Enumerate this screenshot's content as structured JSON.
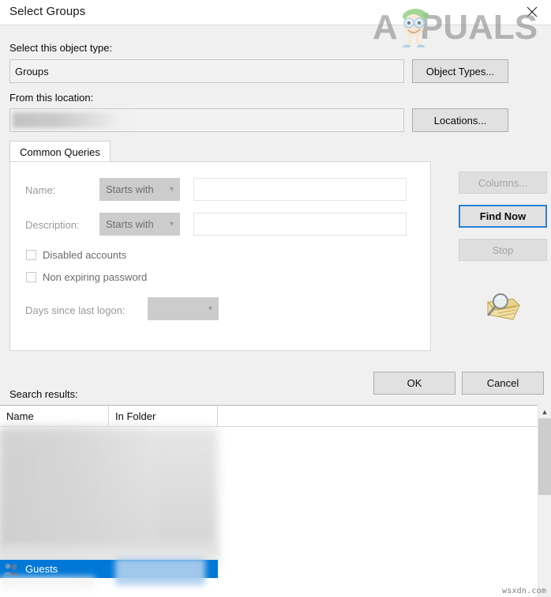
{
  "window": {
    "title": "Select Groups",
    "close_icon": "close-x-icon"
  },
  "watermark": {
    "brand": "APPUALS",
    "footer": "wsxdn.com"
  },
  "object_type": {
    "label": "Select this object type:",
    "value": "Groups",
    "button": "Object Types..."
  },
  "location": {
    "label": "From this location:",
    "value": "",
    "button": "Locations..."
  },
  "tabs": [
    {
      "label": "Common Queries",
      "active": true
    }
  ],
  "query": {
    "name_label": "Name:",
    "name_condition": "Starts with",
    "name_value": "",
    "description_label": "Description:",
    "description_condition": "Starts with",
    "description_value": "",
    "disabled_accounts_label": "Disabled accounts",
    "disabled_accounts_checked": false,
    "non_expiring_password_label": "Non expiring password",
    "non_expiring_password_checked": false,
    "days_since_logon_label": "Days since last logon:",
    "days_since_logon_value": "",
    "caret_icon": "chevron-down-icon"
  },
  "side_buttons": {
    "columns": "Columns...",
    "find_now": "Find Now",
    "stop": "Stop",
    "search_icon": "search-folder-icon"
  },
  "dialog_buttons": {
    "ok": "OK",
    "cancel": "Cancel"
  },
  "results": {
    "label": "Search results:",
    "columns": [
      "Name",
      "In Folder"
    ],
    "rows": [
      {
        "name": "Guests",
        "in_folder": "",
        "selected": true,
        "icon": "group-users-icon"
      }
    ]
  },
  "scrollbar": {
    "up_icon": "chevron-up-icon"
  },
  "colors": {
    "accent": "#0078d7",
    "default_button_border": "#2a7fd4",
    "dialog_bg": "#f0f0f0",
    "panel_bg": "#ffffff",
    "disabled_text": "#a3a3a3"
  }
}
